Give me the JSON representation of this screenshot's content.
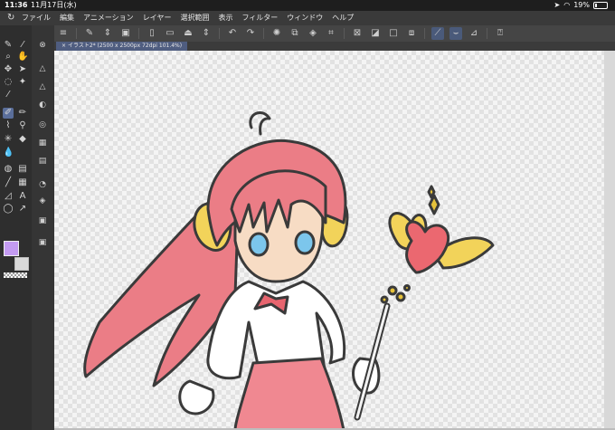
{
  "status": {
    "time": "11:36",
    "date": "11月17日(水)",
    "battery": "19%"
  },
  "menu": [
    "ファイル",
    "編集",
    "アニメーション",
    "レイヤー",
    "選択範囲",
    "表示",
    "フィルター",
    "ウィンドウ",
    "ヘルプ"
  ],
  "tab": {
    "label": "イラスト2* (2500 x 2500px 72dpi 101.4%)"
  },
  "colors": {
    "foreground": "#c49bf2",
    "background": "#d9d9d9",
    "accent": "#4f5d80"
  }
}
